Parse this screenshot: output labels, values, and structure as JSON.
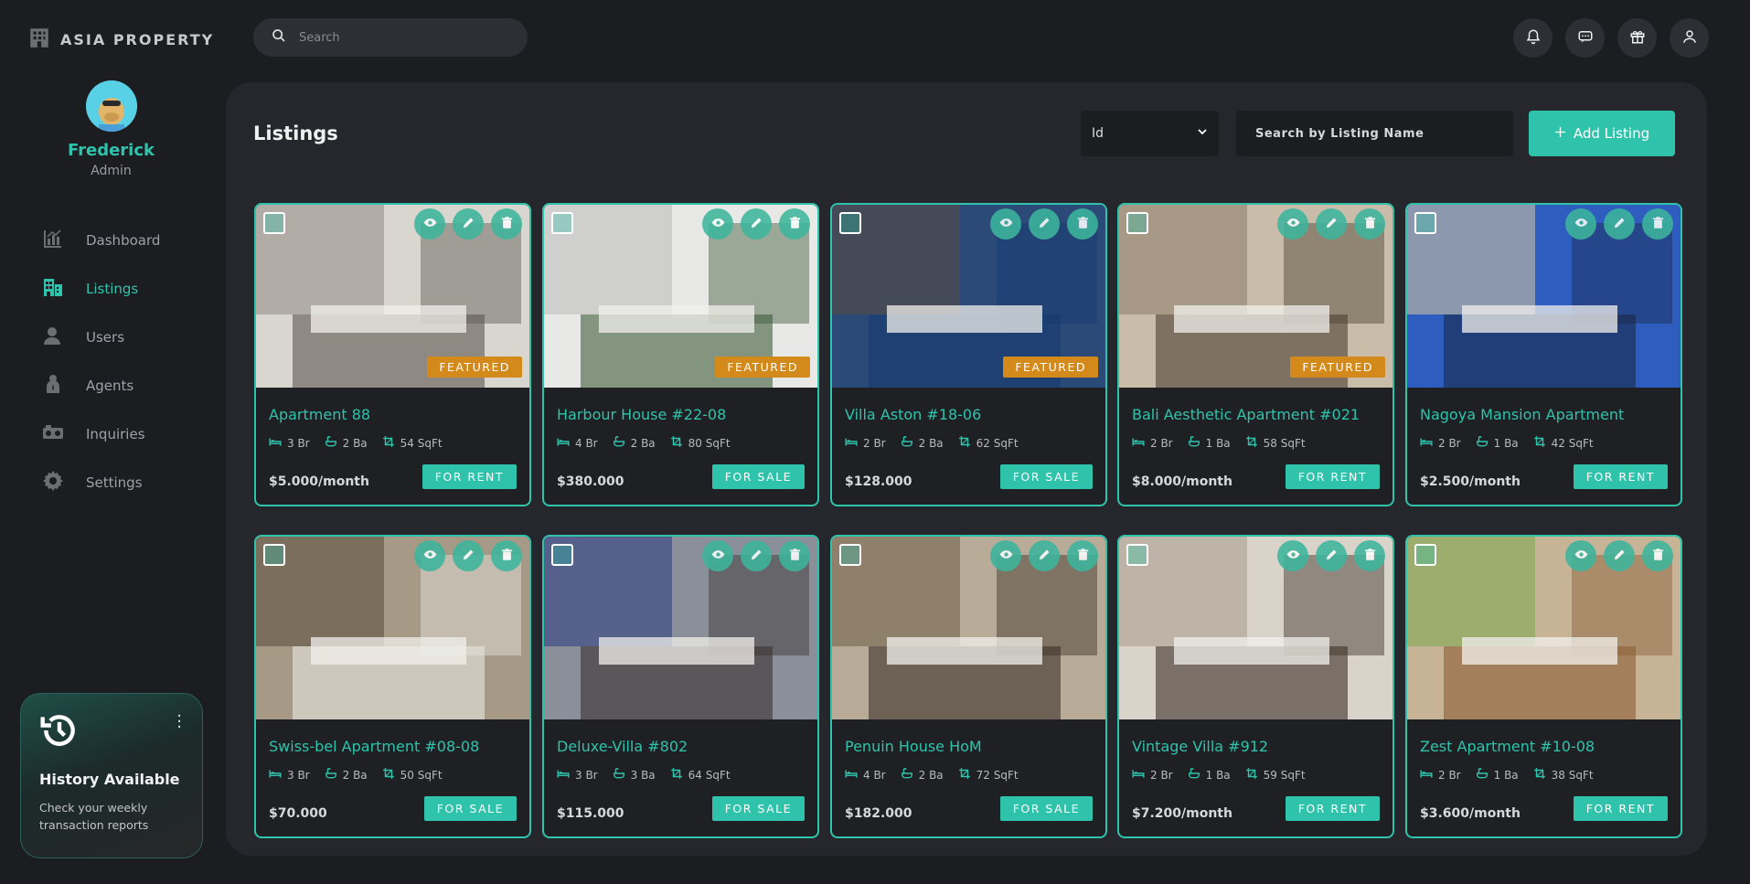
{
  "app": {
    "brand": "ASIA PROPERTY"
  },
  "search": {
    "placeholder": "Search"
  },
  "user": {
    "name": "Frederick",
    "role": "Admin"
  },
  "nav": [
    {
      "label": "Dashboard",
      "icon": "chart-icon"
    },
    {
      "label": "Listings",
      "icon": "building-icon",
      "active": true
    },
    {
      "label": "Users",
      "icon": "user-icon"
    },
    {
      "label": "Agents",
      "icon": "agent-icon"
    },
    {
      "label": "Inquiries",
      "icon": "inbox-icon"
    },
    {
      "label": "Settings",
      "icon": "gear-icon"
    }
  ],
  "history": {
    "title": "History Available",
    "text": "Check your weekly transaction reports"
  },
  "main": {
    "title": "Listings",
    "sort_value": "Id",
    "search_placeholder": "Search by Listing Name",
    "add_label": "Add Listing"
  },
  "listings": [
    {
      "title": "Apartment 88",
      "br": "3 Br",
      "ba": "2 Ba",
      "sqft": "54 SqFt",
      "price": "$5.000/month",
      "status": "FOR RENT",
      "featured": "FEATURED"
    },
    {
      "title": "Harbour House #22-08",
      "br": "4 Br",
      "ba": "2 Ba",
      "sqft": "80 SqFt",
      "price": "$380.000",
      "status": "FOR SALE",
      "featured": "FEATURED"
    },
    {
      "title": "Villa Aston #18-06",
      "br": "2 Br",
      "ba": "2 Ba",
      "sqft": "62 SqFt",
      "price": "$128.000",
      "status": "FOR SALE",
      "featured": "FEATURED"
    },
    {
      "title": "Bali Aesthetic Apartment #021",
      "br": "2 Br",
      "ba": "1 Ba",
      "sqft": "58 SqFt",
      "price": "$8.000/month",
      "status": "FOR RENT",
      "featured": "FEATURED"
    },
    {
      "title": "Nagoya Mansion Apartment",
      "br": "2 Br",
      "ba": "1 Ba",
      "sqft": "42 SqFt",
      "price": "$2.500/month",
      "status": "FOR RENT",
      "featured": ""
    },
    {
      "title": "Swiss-bel Apartment #08-08",
      "br": "3 Br",
      "ba": "2 Ba",
      "sqft": "50 SqFt",
      "price": "$70.000",
      "status": "FOR SALE",
      "featured": ""
    },
    {
      "title": "Deluxe-Villa #802",
      "br": "3 Br",
      "ba": "3 Ba",
      "sqft": "64 SqFt",
      "price": "$115.000",
      "status": "FOR SALE",
      "featured": ""
    },
    {
      "title": "Penuin House HoM",
      "br": "4 Br",
      "ba": "2 Ba",
      "sqft": "72 SqFt",
      "price": "$182.000",
      "status": "FOR SALE",
      "featured": ""
    },
    {
      "title": "Vintage Villa #912",
      "br": "2 Br",
      "ba": "1 Ba",
      "sqft": "59 SqFt",
      "price": "$7.200/month",
      "status": "FOR RENT",
      "featured": ""
    },
    {
      "title": "Zest Apartment #10-08",
      "br": "2 Br",
      "ba": "1 Ba",
      "sqft": "38 SqFt",
      "price": "$3.600/month",
      "status": "FOR RENT",
      "featured": ""
    }
  ]
}
